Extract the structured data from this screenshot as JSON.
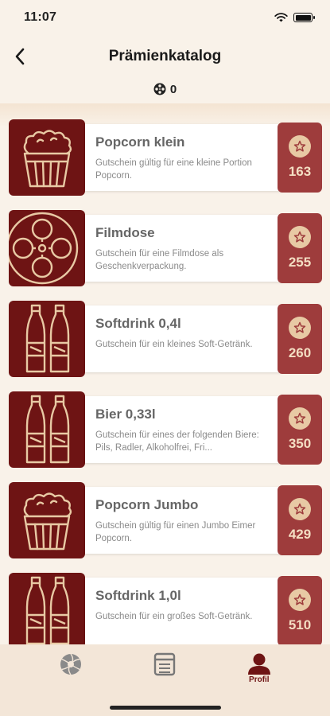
{
  "status": {
    "time": "11:07"
  },
  "nav": {
    "title": "Prämienkatalog",
    "back_icon": "chevron-left-icon"
  },
  "points": {
    "icon": "film-reel-icon",
    "value": "0"
  },
  "colors": {
    "brand_dark": "#6e1414",
    "price_bg": "#9e3c3c",
    "line_art": "#e8c9a4",
    "background": "#f9f2e9"
  },
  "rewards": [
    {
      "title": "Popcorn klein",
      "desc": "Gutschein gültig für eine kleine Portion Popcorn.",
      "price": "163",
      "icon": "popcorn-icon"
    },
    {
      "title": "Filmdose",
      "desc": "Gutschein für eine Filmdose als Geschenkverpackung.",
      "price": "255",
      "icon": "film-reel-icon"
    },
    {
      "title": "Softdrink 0,4l",
      "desc": "Gutschein für ein kleines Soft-Getränk.",
      "price": "260",
      "icon": "bottles-icon"
    },
    {
      "title": "Bier 0,33l",
      "desc": "Gutschein für eines der folgenden Biere: Pils, Radler, Alkoholfrei, Fri...",
      "price": "350",
      "icon": "bottles-icon"
    },
    {
      "title": "Popcorn Jumbo",
      "desc": "Gutschein gültig für einen Jumbo Eimer Popcorn.",
      "price": "429",
      "icon": "popcorn-icon"
    },
    {
      "title": "Softdrink 1,0l",
      "desc": "Gutschein für ein großes Soft-Getränk.",
      "price": "510",
      "icon": "bottles-icon"
    }
  ],
  "tabs": [
    {
      "label": "",
      "icon": "aperture-icon"
    },
    {
      "label": "",
      "icon": "list-icon"
    },
    {
      "label": "Profil",
      "icon": "user-icon",
      "active": true
    }
  ]
}
